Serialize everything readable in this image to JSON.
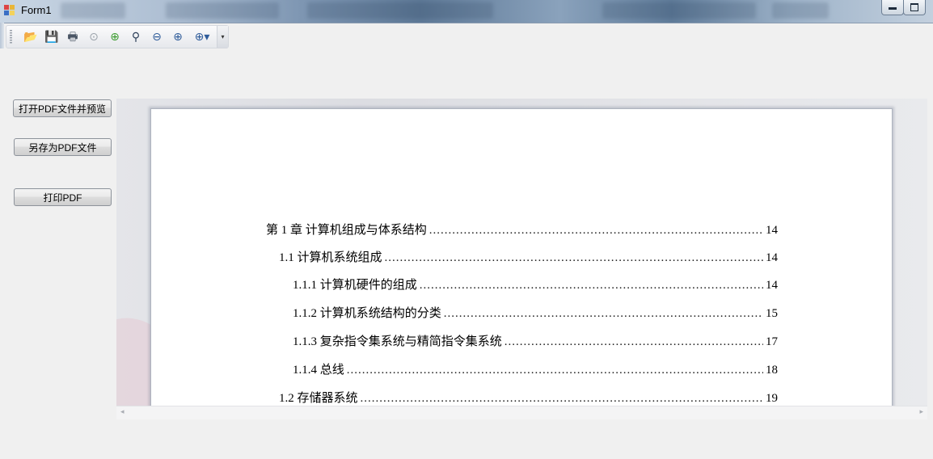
{
  "window": {
    "title": "Form1",
    "minimize_glyph": "▁",
    "maximize_glyph": "□"
  },
  "toolbar": {
    "items": [
      {
        "icon": "open-folder-icon",
        "glyph": "📂",
        "color": "#e0a62a"
      },
      {
        "icon": "save-icon",
        "glyph": "💾",
        "color": "#2b4f8a"
      },
      {
        "icon": "print-icon",
        "glyph": "🖶",
        "color": "#4a5564"
      },
      {
        "icon": "previous-page-icon",
        "glyph": "⊙",
        "color": "#9ca3ab"
      },
      {
        "icon": "next-page-icon",
        "glyph": "⊕",
        "color": "#3b9b2f"
      },
      {
        "icon": "find-binoculars-icon",
        "glyph": "⚲",
        "color": "#2c3e58"
      },
      {
        "icon": "zoom-out-icon",
        "glyph": "⊖",
        "color": "#2f5c9a"
      },
      {
        "icon": "zoom-in-icon",
        "glyph": "⊕",
        "color": "#2f5c9a"
      },
      {
        "icon": "zoom-dropdown-icon",
        "glyph": "⊕▾",
        "color": "#2f5c9a"
      }
    ],
    "overflow_glyph": "▾"
  },
  "buttons": {
    "open_preview": "打开PDF文件并预览",
    "save_as_pdf": "另存为PDF文件",
    "print_pdf": "打印PDF"
  },
  "toc": [
    {
      "title": "第 1 章  计算机组成与体系结构",
      "page": "14"
    },
    {
      "title": "1.1  计算机系统组成",
      "page": "14"
    },
    {
      "title": "1.1.1 计算机硬件的组成",
      "page": "14"
    },
    {
      "title": "1.1.2 计算机系统结构的分类",
      "page": "15"
    },
    {
      "title": "1.1.3 复杂指令集系统与精简指令集系统",
      "page": "17"
    },
    {
      "title": "1.1.4 总线",
      "page": "18"
    },
    {
      "title": "1.2  存储器系统",
      "page": "19"
    }
  ],
  "scrollbar": {
    "left_arrow": "◂",
    "right_arrow": "▸"
  }
}
